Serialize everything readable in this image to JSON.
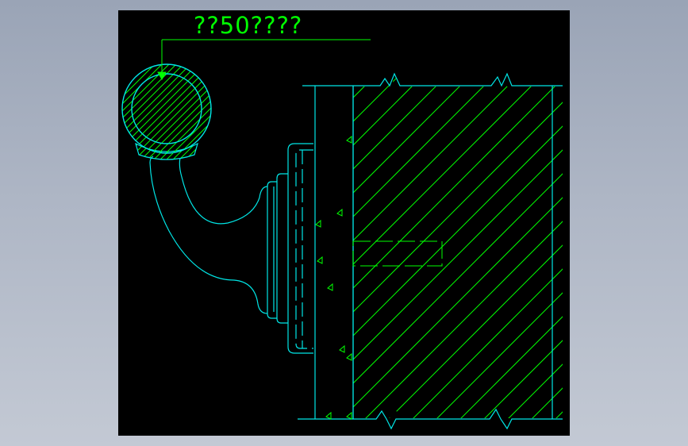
{
  "drawing": {
    "annotation_text": "??50????",
    "colors": {
      "background": "#000000",
      "cyan": "#00e5e5",
      "green": "#00ff00",
      "page": "#a8b0c0"
    }
  }
}
